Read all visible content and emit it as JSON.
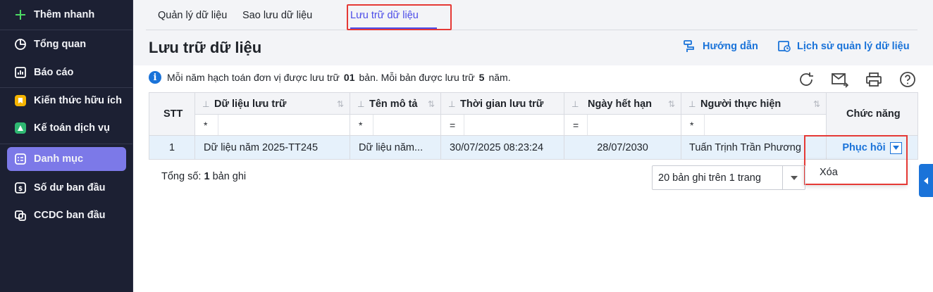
{
  "sidebar": {
    "items": [
      {
        "label": "Thêm nhanh",
        "icon": "plus-icon"
      },
      {
        "label": "Tổng quan",
        "icon": "pie-chart-icon"
      },
      {
        "label": "Báo cáo",
        "icon": "report-chart-icon"
      },
      {
        "label": "Kiến thức hữu ích",
        "icon": "knowledge-icon"
      },
      {
        "label": "Kế toán dịch vụ",
        "icon": "accounting-service-icon"
      },
      {
        "label": "Danh mục",
        "icon": "catalog-icon"
      },
      {
        "label": "Số dư ban đầu",
        "icon": "opening-balance-icon"
      },
      {
        "label": "CCDC ban đầu",
        "icon": "tools-icon"
      }
    ]
  },
  "tabs": [
    "Quản lý dữ liệu",
    "Sao lưu dữ liệu",
    "Lưu trữ dữ liệu"
  ],
  "header": {
    "title": "Lưu trữ dữ liệu",
    "guide": "Hướng dẫn",
    "history": "Lịch sử quản lý dữ liệu"
  },
  "info": {
    "part1": "Mỗi năm hạch toán đơn vị được lưu trữ",
    "count": "01",
    "part2": "bản. Mỗi bản được lưu trữ",
    "years": "5",
    "part3": "năm."
  },
  "table": {
    "columns": {
      "stt": "STT",
      "data": "Dữ liệu lưu trữ",
      "desc": "Tên mô tả",
      "time": "Thời gian lưu trữ",
      "expiry": "Ngày hết hạn",
      "user": "Người thực hiện",
      "func": "Chức năng"
    },
    "filters": {
      "data": "*",
      "desc": "*",
      "time": "=",
      "expiry": "=",
      "user": "*"
    },
    "rows": [
      {
        "stt": "1",
        "data": "Dữ liệu năm 2025-TT245",
        "desc": "Dữ liệu năm...",
        "time": "30/07/2025 08:23:24",
        "expiry": "28/07/2030",
        "user": "Tuấn Trịnh Trần Phương",
        "action": "Phục hồi"
      }
    ]
  },
  "dropdown": {
    "delete": "Xóa"
  },
  "footer": {
    "total_label": "Tổng số:",
    "total_count": "1",
    "total_suffix": "bản ghi",
    "page_size": "20 bản ghi trên 1 trang"
  }
}
